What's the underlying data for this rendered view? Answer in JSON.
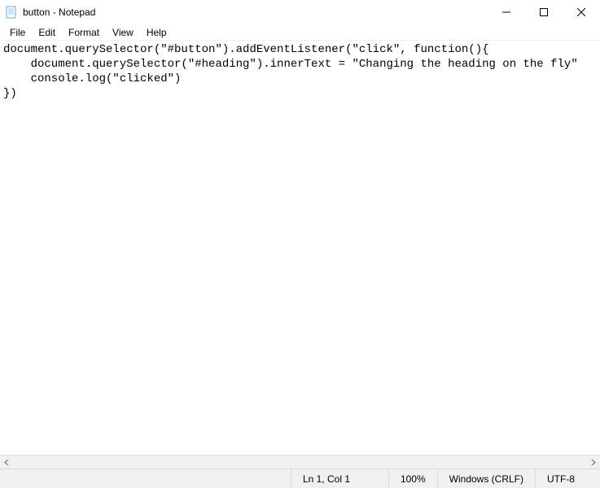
{
  "titlebar": {
    "title": "button - Notepad"
  },
  "menubar": {
    "file": "File",
    "edit": "Edit",
    "format": "Format",
    "view": "View",
    "help": "Help"
  },
  "editor": {
    "content": "document.querySelector(\"#button\").addEventListener(\"click\", function(){\n    document.querySelector(\"#heading\").innerText = \"Changing the heading on the fly\"\n    console.log(\"clicked\")\n})"
  },
  "statusbar": {
    "linecol": "Ln 1, Col 1",
    "zoom": "100%",
    "eol": "Windows (CRLF)",
    "encoding": "UTF-8"
  }
}
